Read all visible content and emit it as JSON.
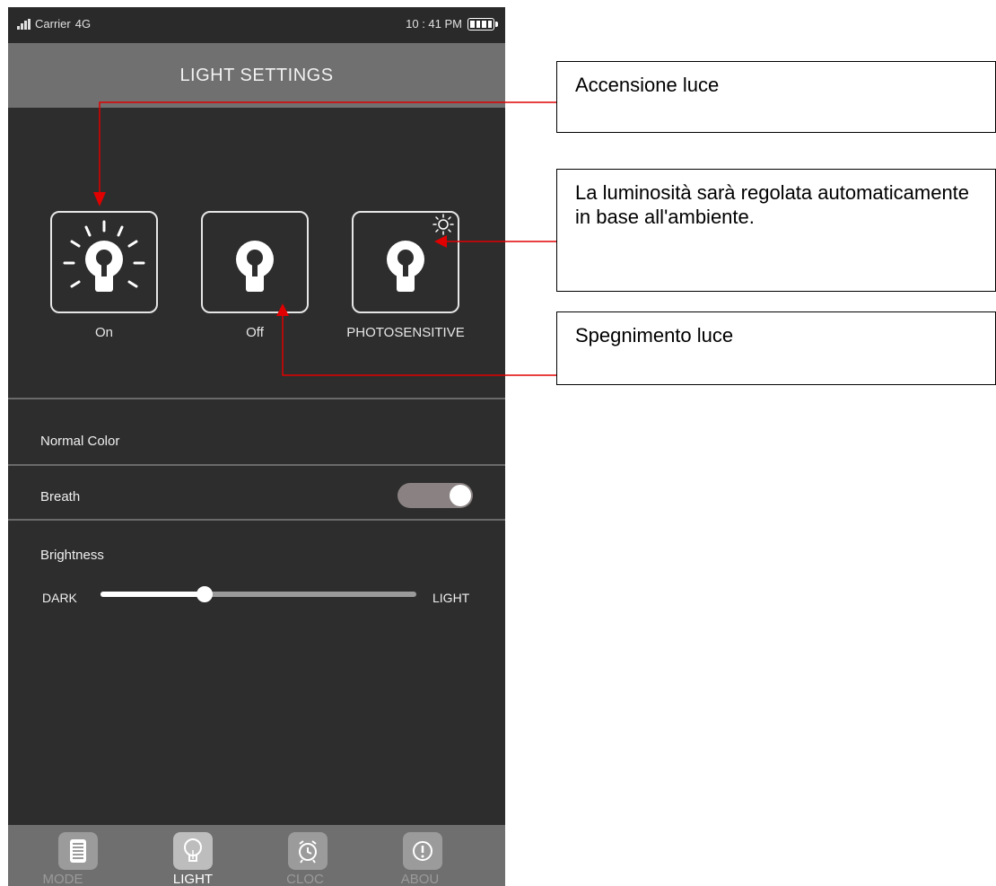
{
  "status_bar": {
    "carrier": "Carrier",
    "network": "4G",
    "time": "10 : 41 PM"
  },
  "header": {
    "title": "LIGHT SETTINGS"
  },
  "light_modes": [
    {
      "label": "On",
      "icon": "bulb-rays-icon"
    },
    {
      "label": "Off",
      "icon": "bulb-icon"
    },
    {
      "label": "PHOTOSENSITIVE",
      "icon": "bulb-sun-icon"
    }
  ],
  "settings": {
    "normal_color": "Normal Color",
    "breath": {
      "label": "Breath",
      "on": true
    },
    "brightness": {
      "label": "Brightness",
      "min_label": "DARK",
      "max_label": "LIGHT",
      "value": 0.33
    }
  },
  "tabs": [
    {
      "label": "MODE",
      "icon": "list-icon",
      "active": false
    },
    {
      "label": "LIGHT",
      "icon": "bulb-icon",
      "active": true
    },
    {
      "label": "CLOC",
      "icon": "alarm-clock-icon",
      "active": false
    },
    {
      "label": "ABOU",
      "icon": "info-icon",
      "active": false
    }
  ],
  "callouts": {
    "on": "Accensione luce",
    "photosensitive": "La luminosità sarà regolata automaticamente in base all'ambiente.",
    "off": "Spegnimento luce"
  },
  "colors": {
    "annotation_arrow": "#e00000",
    "background": "#2d2d2d",
    "header": "#707070",
    "tabbar": "#6f6f6f"
  }
}
